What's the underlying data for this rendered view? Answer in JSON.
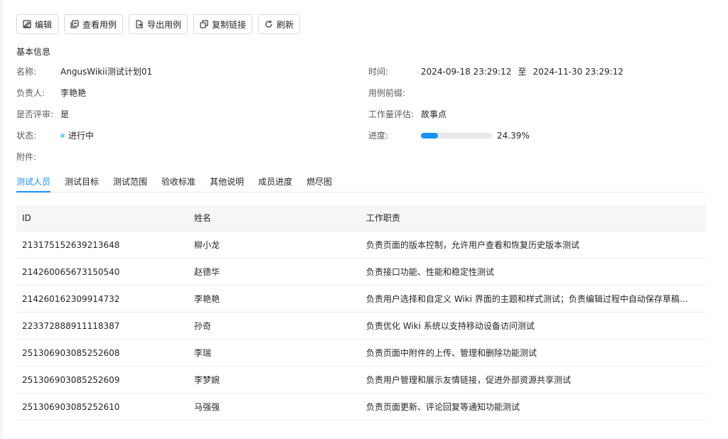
{
  "toolbar": {
    "buttons": [
      {
        "label": "编辑",
        "icon": "edit-icon"
      },
      {
        "label": "查看用例",
        "icon": "view-cases-icon"
      },
      {
        "label": "导出用例",
        "icon": "export-icon"
      },
      {
        "label": "复制链接",
        "icon": "copy-icon"
      },
      {
        "label": "刷新",
        "icon": "refresh-icon"
      }
    ]
  },
  "basic_info": {
    "title": "基本信息",
    "name_label": "名称:",
    "name_value": "AngusWikii测试计划01",
    "owner_label": "负责人:",
    "owner_value": "李艳艳",
    "review_label": "是否评审:",
    "review_value": "是",
    "status_label": "状态:",
    "status_value": "进行中",
    "status_color": "#67d7ff",
    "attachment_label": "附件:",
    "time_label": "时间:",
    "time_start": "2024-09-18 23:29:12",
    "time_sep": "至",
    "time_end": "2024-11-30 23:29:12",
    "prefix_label": "用例前缀:",
    "workload_label": "工作量评估:",
    "workload_value": "故事点",
    "progress_label": "进度:",
    "progress_percent": 24.39,
    "progress_text": "24.39%",
    "progress_color": "#1890ff"
  },
  "tabs": [
    {
      "label": "测试人员",
      "active": true
    },
    {
      "label": "测试目标",
      "active": false
    },
    {
      "label": "测试范围",
      "active": false
    },
    {
      "label": "验收标准",
      "active": false
    },
    {
      "label": "其他说明",
      "active": false
    },
    {
      "label": "成员进度",
      "active": false
    },
    {
      "label": "燃尽图",
      "active": false
    }
  ],
  "table": {
    "headers": {
      "id": "ID",
      "name": "姓名",
      "duty": "工作职责"
    },
    "rows": [
      {
        "id": "213175152639213648",
        "name": "柳小龙",
        "duty": "负责页面的版本控制，允许用户查看和恢复历史版本测试"
      },
      {
        "id": "214260065673150540",
        "name": "赵德华",
        "duty": "负责接口功能、性能和稳定性测试"
      },
      {
        "id": "214260162309914732",
        "name": "李艳艳",
        "duty": "负责用户选择和自定义 Wiki 界面的主题和样式测试；负责编辑过程中自动保存草稿，..."
      },
      {
        "id": "223372888911118387",
        "name": "孙奇",
        "duty": "负责优化 Wiki 系统以支持移动设备访问测试"
      },
      {
        "id": "251306903085252608",
        "name": "李瑞",
        "duty": "负责页面中附件的上传、管理和删除功能测试"
      },
      {
        "id": "251306903085252609",
        "name": "李梦婉",
        "duty": "负责用户管理和展示友情链接，促进外部资源共享测试"
      },
      {
        "id": "251306903085252610",
        "name": "马强强",
        "duty": "负责页面更新、评论回复等通知功能测试"
      }
    ]
  }
}
